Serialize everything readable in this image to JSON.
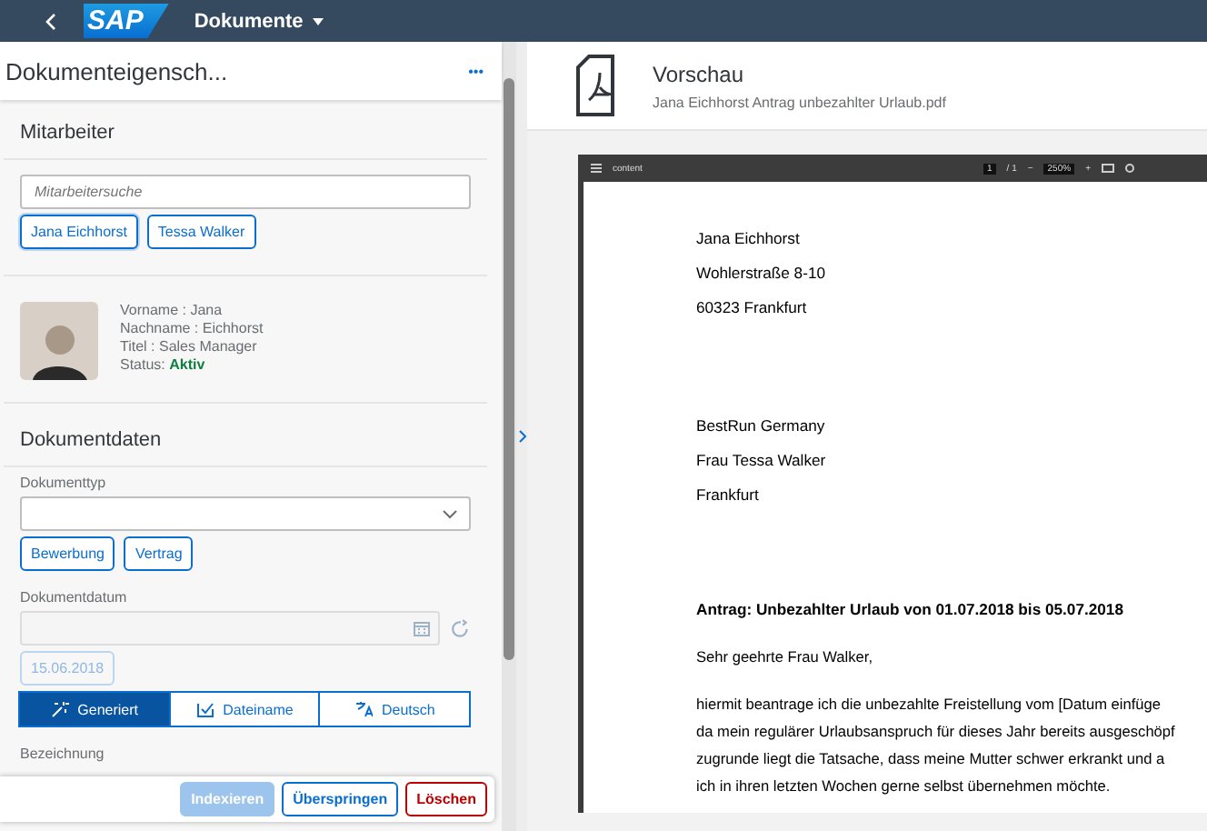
{
  "shell": {
    "title": "Dokumente",
    "logo": "SAP"
  },
  "properties": {
    "title": "Dokumenteigensch...",
    "more": "•••",
    "employee_section": {
      "title": "Mitarbeiter",
      "search": {
        "placeholder": "Mitarbeitersuche"
      },
      "suggestions": [
        {
          "label": "Jana Eichhorst",
          "selected": true
        },
        {
          "label": "Tessa Walker",
          "selected": false
        }
      ],
      "card": {
        "lines": [
          "Vorname : Jana",
          "Nachname : Eichhorst",
          "Titel : Sales Manager"
        ],
        "status_label": "Status:",
        "status": "Aktiv"
      }
    },
    "document_section": {
      "title": "Dokumentdaten",
      "type_label": "Dokumenttyp",
      "type_suggestions": [
        "Bewerbung",
        "Vertrag"
      ],
      "date_label": "Dokumentdatum",
      "date_suggestion": "15.06.2018",
      "modes": [
        {
          "label": "Generiert",
          "selected": true,
          "kind": "wand"
        },
        {
          "label": "Dateiname",
          "selected": false,
          "kind": "file"
        },
        {
          "label": "Deutsch",
          "selected": false,
          "kind": "language"
        }
      ],
      "name_label": "Bezeichnung"
    },
    "footer": [
      {
        "label": "Indexieren",
        "kind": "primary",
        "disabled": true
      },
      {
        "label": "Überspringen",
        "kind": "default",
        "disabled": false
      },
      {
        "label": "Löschen",
        "kind": "reject",
        "disabled": false
      }
    ]
  },
  "preview": {
    "title": "Vorschau",
    "filename": "Jana Eichhorst Antrag unbezahlter Urlaub.pdf",
    "viewer": {
      "doc_title": "content",
      "page": "1",
      "pages": "/ 1",
      "zoom_out": "−",
      "zoom": "250%",
      "zoom_in": "+"
    },
    "blocks": [
      {
        "kind": "address",
        "lines": [
          "Jana Eichhorst",
          "Wohlerstraße 8-10",
          "60323 Frankfurt"
        ]
      },
      {
        "kind": "address",
        "lines": [
          "BestRun Germany",
          "Frau Tessa Walker",
          "Frankfurt"
        ]
      },
      {
        "kind": "subject",
        "lines": [
          "Antrag: Unbezahlter Urlaub von 01.07.2018 bis 05.07.2018"
        ]
      },
      {
        "kind": "text",
        "lines": [
          "Sehr geehrte Frau Walker,"
        ]
      },
      {
        "kind": "text",
        "lines": [
          "hiermit beantrage ich die unbezahlte Freistellung vom [Datum einfüge",
          "da mein regulärer Urlaubsanspruch für dieses Jahr bereits ausgeschöpf",
          "zugrunde liegt die Tatsache, dass meine Mutter schwer erkrankt und a",
          "ich in ihren letzten Wochen gerne selbst übernehmen möchte."
        ]
      }
    ]
  }
}
